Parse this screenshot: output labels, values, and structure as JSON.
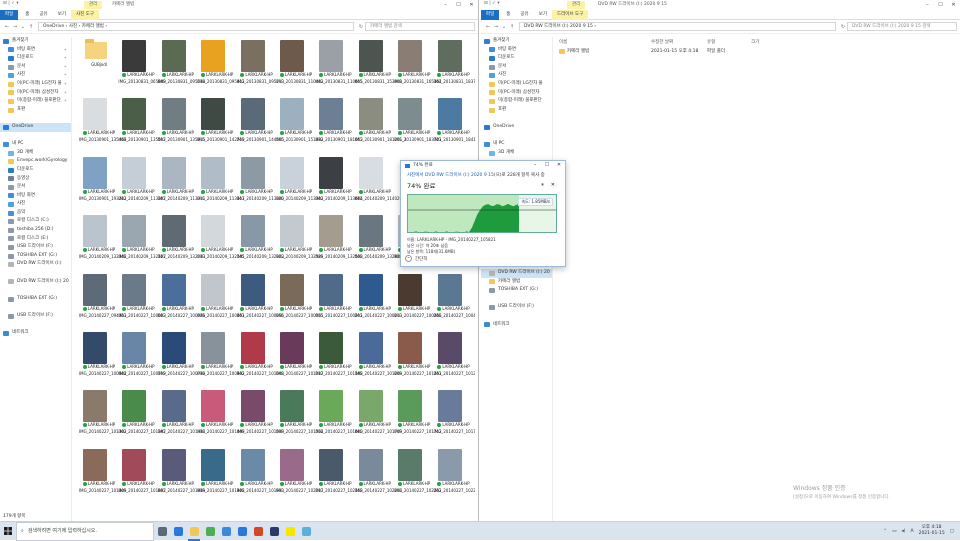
{
  "left_window": {
    "context_tab": "관리",
    "title": "카메라 앨범",
    "ribbon_tabs": [
      "파일",
      "홈",
      "공유",
      "보기",
      "사진 도구"
    ],
    "path": "OneDrive › 사진 › 카메라 앨범 ›",
    "search_placeholder": "카메라 앨범 검색",
    "status": "179개 항목",
    "nav": [
      {
        "label": "즐겨찾기",
        "icon": "star-icon",
        "color": "#2f7fd8",
        "pin": false
      },
      {
        "label": "바탕 화면",
        "icon": "desktop-icon",
        "color": "#3b8fe0",
        "pin": true
      },
      {
        "label": "다운로드",
        "icon": "download-icon",
        "color": "#2a7cc7",
        "pin": true
      },
      {
        "label": "문서",
        "icon": "document-icon",
        "color": "#8a9bb0",
        "pin": true
      },
      {
        "label": "사진",
        "icon": "pictures-icon",
        "color": "#4aa3df",
        "pin": true
      },
      {
        "label": "이(PC-미래) LG전자 물",
        "icon": "folder-icon",
        "color": "#f0c85a",
        "pin": true
      },
      {
        "label": "미(PC-미래) 삼성전자",
        "icon": "folder-icon",
        "color": "#f0c85a",
        "pin": true
      },
      {
        "label": "미(종합-미래) 블로판단",
        "icon": "folder-icon",
        "color": "#f0c85a",
        "pin": true
      },
      {
        "label": "포판",
        "icon": "folder-icon",
        "color": "#f0c85a",
        "pin": false
      },
      {
        "label": "",
        "icon": "blank",
        "color": "#ffffff",
        "pin": false
      },
      {
        "label": "OneDrive",
        "icon": "cloud-icon",
        "color": "#2b79d6",
        "pin": false,
        "selected": true
      },
      {
        "label": "",
        "icon": "blank",
        "color": "#ffffff",
        "pin": false
      },
      {
        "label": "내 PC",
        "icon": "pc-icon",
        "color": "#3e8ed8",
        "pin": false
      },
      {
        "label": "3D 개체",
        "icon": "cube-icon",
        "color": "#6fb6e8",
        "pin": false
      },
      {
        "label": "Envepc.work\\Gyrology",
        "icon": "folder-icon",
        "color": "#f0c85a",
        "pin": false
      },
      {
        "label": "다운로드",
        "icon": "download-icon",
        "color": "#2a7cc7",
        "pin": false
      },
      {
        "label": "동영상",
        "icon": "video-icon",
        "color": "#6d7f95",
        "pin": false
      },
      {
        "label": "문서",
        "icon": "document-icon",
        "color": "#8a9bb0",
        "pin": false
      },
      {
        "label": "바탕 화면",
        "icon": "desktop-icon",
        "color": "#3b8fe0",
        "pin": false
      },
      {
        "label": "사진",
        "icon": "pictures-icon",
        "color": "#4aa3df",
        "pin": false
      },
      {
        "label": "음악",
        "icon": "music-icon",
        "color": "#4a8fd8",
        "pin": false
      },
      {
        "label": "로컬 디스크 (C:)",
        "icon": "drive-icon",
        "color": "#8d99a6",
        "pin": false
      },
      {
        "label": "toshiba 256 (D:)",
        "icon": "drive-icon",
        "color": "#8d99a6",
        "pin": false
      },
      {
        "label": "로컬 디스크 (E:)",
        "icon": "drive-icon",
        "color": "#8d99a6",
        "pin": false
      },
      {
        "label": "USB 드라이브 (F:)",
        "icon": "usb-icon",
        "color": "#8d99a6",
        "pin": false
      },
      {
        "label": "TOSHIBA EXT (G:)",
        "icon": "drive-icon",
        "color": "#8d99a6",
        "pin": false
      },
      {
        "label": "DVD RW 드라이브 (I:)",
        "icon": "dvd-icon",
        "color": "#b5b5b5",
        "pin": false
      },
      {
        "label": "",
        "icon": "blank",
        "color": "#ffffff",
        "pin": false
      },
      {
        "label": "DVD RW 드라이브 (I:) 20",
        "icon": "dvd-icon",
        "color": "#b5b5b5",
        "pin": false
      },
      {
        "label": "",
        "icon": "blank",
        "color": "#ffffff",
        "pin": false
      },
      {
        "label": "TOSHIBA EXT (G:)",
        "icon": "drive-icon",
        "color": "#8d99a6",
        "pin": false
      },
      {
        "label": "",
        "icon": "blank",
        "color": "#ffffff",
        "pin": false
      },
      {
        "label": "USB 드라이브 (F:)",
        "icon": "usb-icon",
        "color": "#8d99a6",
        "pin": false
      },
      {
        "label": "",
        "icon": "blank",
        "color": "#ffffff",
        "pin": false
      },
      {
        "label": "네트워크",
        "icon": "network-icon",
        "color": "#3a8ad8",
        "pin": false
      }
    ],
    "files": [
      {
        "name": "GUBjxdl",
        "kind": "folder"
      },
      {
        "name": "IMG_20130831_065849",
        "color": "#3a3a3a"
      },
      {
        "name": "IMG_20130831_095138",
        "color": "#5b6a52"
      },
      {
        "name": "IMG_20130831_095412",
        "color": "#e8a21f"
      },
      {
        "name": "IMG_20130831_095713",
        "color": "#7a6f60"
      },
      {
        "name": "IMG_20130831_110442",
        "color": "#6d5a4c"
      },
      {
        "name": "IMG_20130831_110615",
        "color": "#9aa0a5"
      },
      {
        "name": "IMG_20130831_153908",
        "color": "#4d5550"
      },
      {
        "name": "IMG_20130831_165354",
        "color": "#8a7e74"
      },
      {
        "name": "IMG_20130831_183722",
        "color": "#5e6d5d"
      },
      {
        "name": "IMG_20130901_135458",
        "color": "#d9dde0"
      },
      {
        "name": "IMG_20130901_135517",
        "color": "#4a5e48"
      },
      {
        "name": "IMG_20130901_135815",
        "color": "#707e84"
      },
      {
        "name": "IMG_20130901_142719",
        "color": "#3f4a45"
      },
      {
        "name": "IMG_20130901_144505",
        "color": "#5a6a78"
      },
      {
        "name": "IMG_20130901_151832",
        "color": "#9cb0c0"
      },
      {
        "name": "IMG_20130901_181053",
        "color": "#6c7f94"
      },
      {
        "name": "IMG_20130901_181201_1",
        "color": "#8a8d80"
      },
      {
        "name": "IMG_20130901_183721",
        "color": "#7d8d8f"
      },
      {
        "name": "IMG_20130901_184100",
        "color": "#4d7aa0"
      },
      {
        "name": "IMG_20130901_193212",
        "color": "#7fa1c4"
      },
      {
        "name": "IMG_20140209_113307",
        "color": "#c5cdd6"
      },
      {
        "name": "IMG_20140209_113311",
        "color": "#aab7c3"
      },
      {
        "name": "IMG_20140209_113317",
        "color": "#b0bcc7"
      },
      {
        "name": "IMG_20140209_113320",
        "color": "#8c9aa6"
      },
      {
        "name": "IMG_20140209_113342",
        "color": "#c9d2da"
      },
      {
        "name": "IMG_20140209_113604",
        "color": "#3c4045"
      },
      {
        "name": "IMG_20140209_114029",
        "color": "#d7dde2"
      },
      {
        "name": "",
        "color": "#ffffff",
        "empty": true
      },
      {
        "name": "",
        "color": "#ffffff",
        "empty": true
      },
      {
        "name": "IMG_20140209_132048",
        "color": "#bac4cc"
      },
      {
        "name": "IMG_20140209_132127",
        "color": "#9aa6b0"
      },
      {
        "name": "IMG_20140209_132133",
        "color": "#5f6a72"
      },
      {
        "name": "IMG_20140209_132145",
        "color": "#d2d8dc"
      },
      {
        "name": "IMG_20140209_132322",
        "color": "#8898a6"
      },
      {
        "name": "IMG_20140209_132529",
        "color": "#c2c9cf"
      },
      {
        "name": "IMG_20140209_132538",
        "color": "#a49c8f"
      },
      {
        "name": "IMG_20140209_132823",
        "color": "#6a7680"
      },
      {
        "name": "IMG_20140209_132840",
        "color": "#b4bec8"
      },
      {
        "name": "IMG_20140209_092946",
        "color": "#8b9ba8"
      },
      {
        "name": "IMG_20140227_094051",
        "color": "#5d6b78"
      },
      {
        "name": "IMG_20140227_100023",
        "color": "#6a7a88"
      },
      {
        "name": "IMG_20140227_100026",
        "color": "#4a6f9a"
      },
      {
        "name": "IMG_20140227_100051",
        "color": "#c0c6cc"
      },
      {
        "name": "IMG_20140227_100056",
        "color": "#3d5a7f"
      },
      {
        "name": "IMG_20140227_100155",
        "color": "#7a6a5a"
      },
      {
        "name": "IMG_20140227_100211",
        "color": "#506a8a"
      },
      {
        "name": "IMG_20140227_100213",
        "color": "#2f5a90"
      },
      {
        "name": "IMG_20140227_100256",
        "color": "#4a3a30"
      },
      {
        "name": "IMG_20140227_100458",
        "color": "#5a7892"
      },
      {
        "name": "IMG_20140227_100644",
        "color": "#344a6a"
      },
      {
        "name": "IMG_20140227_100719",
        "color": "#6a86a6"
      },
      {
        "name": "IMG_20140227_100730",
        "color": "#2a4a7a"
      },
      {
        "name": "IMG_20140227_100932",
        "color": "#88929a"
      },
      {
        "name": "IMG_20140227_101048",
        "color": "#b03a4a"
      },
      {
        "name": "IMG_20140227_101117",
        "color": "#6a3a5a"
      },
      {
        "name": "IMG_20140227_101148",
        "color": "#3a5a3a"
      },
      {
        "name": "IMG_20140227_101209",
        "color": "#4a6a9a"
      },
      {
        "name": "IMG_20140227_101251",
        "color": "#8a5a4a"
      },
      {
        "name": "IMG_20140227_101256",
        "color": "#5a4a6a"
      },
      {
        "name": "IMG_20140227_101302",
        "color": "#8a7a6a"
      },
      {
        "name": "IMG_20140227_101347",
        "color": "#4a8a4a"
      },
      {
        "name": "IMG_20140227_101434",
        "color": "#5a6a8a"
      },
      {
        "name": "IMG_20140227_101449",
        "color": "#c85a7a"
      },
      {
        "name": "IMG_20140227_101539",
        "color": "#7a4a6a"
      },
      {
        "name": "IMG_20140227_101554",
        "color": "#4a7a5a"
      },
      {
        "name": "IMG_20140227_101600",
        "color": "#6aa85a"
      },
      {
        "name": "IMG_20140227_101709",
        "color": "#7aa86a"
      },
      {
        "name": "IMG_20140227_101712",
        "color": "#5a9a5a"
      },
      {
        "name": "IMG_20140227_101723",
        "color": "#6a7a9a"
      },
      {
        "name": "IMG_20140227_101809",
        "color": "#8a6a5a"
      },
      {
        "name": "IMG_20140227_101837",
        "color": "#a04a5a"
      },
      {
        "name": "IMG_20140227_101839",
        "color": "#5a5a7a"
      },
      {
        "name": "IMG_20140227_101928",
        "color": "#3a6a8a"
      },
      {
        "name": "IMG_20140227_101933",
        "color": "#6a8aa8"
      },
      {
        "name": "IMG_20140227_102117",
        "color": "#9a6a8a"
      },
      {
        "name": "IMG_20140227_102158",
        "color": "#4a5a6a"
      },
      {
        "name": "IMG_20140227_102204",
        "color": "#7a8a9a"
      },
      {
        "name": "IMG_20140227_102252",
        "color": "#5a7a6a"
      },
      {
        "name": "IMG_20140227_102254",
        "color": "#8a9aaa"
      }
    ]
  },
  "right_window": {
    "context_tab": "관리",
    "title": "DVD RW 드라이브 (I:) 2020 9 15",
    "ribbon_tabs": [
      "파일",
      "홈",
      "공유",
      "보기",
      "드라이브 도구"
    ],
    "path": "DVD RW 드라이브 (I:) 2020 9 15 ›",
    "search_placeholder": "DVD RW 드라이브 (I:) 2020 9 15 검색",
    "columns": [
      "이름",
      "수정한 날짜",
      "유형",
      "크기"
    ],
    "row": {
      "name": "카메라 앨범",
      "date": "2021-01-15 오후 4:18",
      "type": "파일 폴더"
    },
    "nav": [
      {
        "label": "즐겨찾기",
        "icon": "star-icon",
        "color": "#2f7fd8"
      },
      {
        "label": "바탕 화면",
        "icon": "desktop-icon",
        "color": "#3b8fe0"
      },
      {
        "label": "다운로드",
        "icon": "download-icon",
        "color": "#2a7cc7"
      },
      {
        "label": "문서",
        "icon": "document-icon",
        "color": "#8a9bb0"
      },
      {
        "label": "사진",
        "icon": "pictures-icon",
        "color": "#4aa3df"
      },
      {
        "label": "미(PC-미래) LG전자 물",
        "icon": "folder-icon",
        "color": "#f0c85a"
      },
      {
        "label": "미(PC-미래) 삼성전자",
        "icon": "folder-icon",
        "color": "#f0c85a"
      },
      {
        "label": "미(종합-미래) 블로판단",
        "icon": "folder-icon",
        "color": "#f0c85a"
      },
      {
        "label": "포판",
        "icon": "folder-icon",
        "color": "#f0c85a"
      },
      {
        "label": "",
        "icon": "blank",
        "color": "#ffffff"
      },
      {
        "label": "OneDrive",
        "icon": "cloud-icon",
        "color": "#2b79d6"
      },
      {
        "label": "",
        "icon": "blank",
        "color": "#ffffff"
      },
      {
        "label": "내 PC",
        "icon": "pc-icon",
        "color": "#3e8ed8"
      },
      {
        "label": "3D 개체",
        "icon": "cube-icon",
        "color": "#6fb6e8"
      },
      {
        "label": "",
        "icon": "blank",
        "color": "#ffffff"
      },
      {
        "label": "",
        "icon": "blank",
        "color": "#ffffff"
      },
      {
        "label": "",
        "icon": "blank",
        "color": "#ffffff"
      },
      {
        "label": "",
        "icon": "blank",
        "color": "#ffffff"
      },
      {
        "label": "",
        "icon": "blank",
        "color": "#ffffff"
      },
      {
        "label": "",
        "icon": "blank",
        "color": "#ffffff"
      },
      {
        "label": "",
        "icon": "blank",
        "color": "#ffffff"
      },
      {
        "label": "",
        "icon": "blank",
        "color": "#ffffff"
      },
      {
        "label": "",
        "icon": "blank",
        "color": "#ffffff"
      },
      {
        "label": "",
        "icon": "blank",
        "color": "#ffffff"
      },
      {
        "label": "",
        "icon": "blank",
        "color": "#ffffff"
      },
      {
        "label": "DVD RW 드라이브 (I:)",
        "icon": "dvd-icon",
        "color": "#b5b5b5"
      },
      {
        "label": "",
        "icon": "blank",
        "color": "#ffffff"
      },
      {
        "label": "DVD RW 드라이브 (I:) 20",
        "icon": "dvd-icon",
        "color": "#b5b5b5",
        "selected": true
      },
      {
        "label": "카메라 앨범",
        "icon": "folder-icon",
        "color": "#f0c85a"
      },
      {
        "label": "TOSHIBA EXT (G:)",
        "icon": "drive-icon",
        "color": "#8d99a6"
      },
      {
        "label": "",
        "icon": "blank",
        "color": "#ffffff"
      },
      {
        "label": "USB 드라이브 (F:)",
        "icon": "usb-icon",
        "color": "#8d99a6"
      },
      {
        "label": "",
        "icon": "blank",
        "color": "#ffffff"
      },
      {
        "label": "네트워크",
        "icon": "network-icon",
        "color": "#3a8ad8"
      }
    ]
  },
  "copy_dialog": {
    "title": "74% 완료",
    "line1_prefix": "사진에서",
    "line1_dest": "DVD RW 드라이브 (I:) 2020 9 15",
    "line1_suffix": "(으)로 228개 항목 복사 중",
    "percent_text": "74% 완료",
    "progress_percent": 74,
    "speed": "속도: 1.85MB/s",
    "name_line": "이름: LARKLARK-HP - IMG_20140227_105821",
    "time_line": "남은 시간: 약 20초 남음",
    "items_line": "남은 항목: 118개(31.6MB)",
    "less_label": "간단히"
  },
  "taskbar": {
    "search_placeholder": "검색하려면 여기에 입력하십시오.",
    "apps": [
      {
        "name": "task-view-icon",
        "color": "#5a6a7a"
      },
      {
        "name": "edge-icon",
        "color": "#2b79d6"
      },
      {
        "name": "file-explorer-icon",
        "color": "#f0c85a",
        "active": true
      },
      {
        "name": "chrome-icon",
        "color": "#4caf50"
      },
      {
        "name": "store-icon",
        "color": "#3a8ad8"
      },
      {
        "name": "mail-icon",
        "color": "#2b79d6"
      },
      {
        "name": "powerpoint-icon",
        "color": "#d24726"
      },
      {
        "name": "photoshop-icon",
        "color": "#2a3a6a"
      },
      {
        "name": "kakaotalk-icon",
        "color": "#f7e600"
      },
      {
        "name": "app-icon",
        "color": "#5ab0d8"
      }
    ],
    "time": "오후 4:18",
    "date": "2021-01-15",
    "tray_lang": "A"
  },
  "watermark": {
    "title": "Windows 정품 인증",
    "subtitle": "[설정]으로 이동하여 Windows를 정품 인증합니다."
  },
  "tile_caption": "LARKLARK-HP",
  "titlebar_icons": "⊟ | ✓ ▾"
}
